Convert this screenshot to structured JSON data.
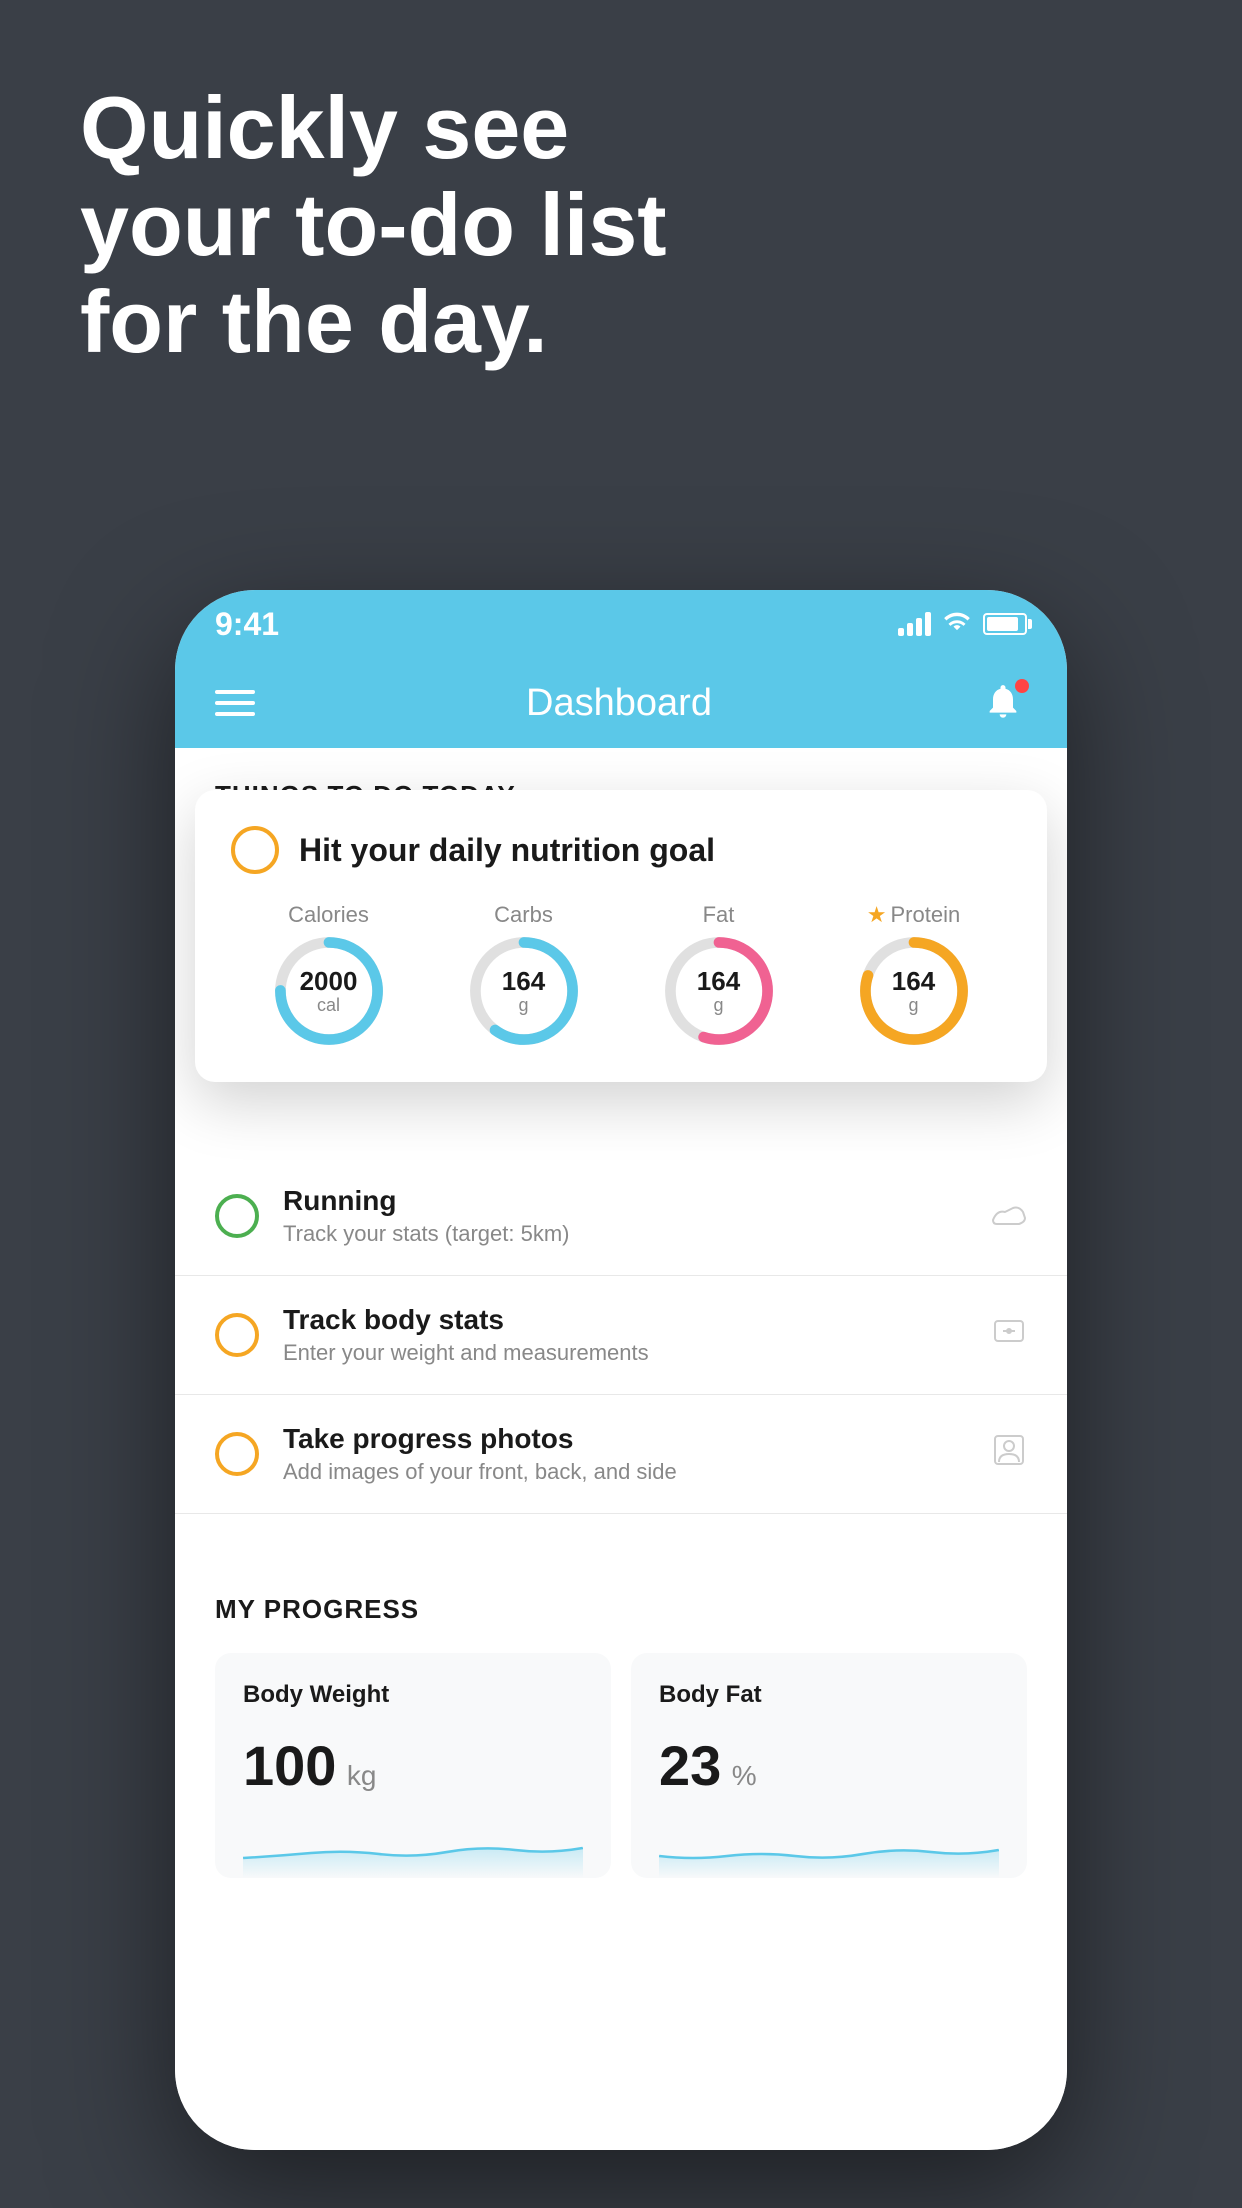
{
  "background_color": "#3a3f47",
  "headline": {
    "line1": "Quickly see",
    "line2": "your to-do list",
    "line3": "for the day."
  },
  "status_bar": {
    "time": "9:41",
    "color": "#5bc8e8"
  },
  "nav": {
    "title": "Dashboard",
    "color": "#5bc8e8"
  },
  "things_section": {
    "title": "THINGS TO DO TODAY"
  },
  "nutrition_card": {
    "title": "Hit your daily nutrition goal",
    "items": [
      {
        "label": "Calories",
        "value": "2000",
        "unit": "cal",
        "color": "#5bc8e8",
        "track_color": "#e0e0e0",
        "pct": 75
      },
      {
        "label": "Carbs",
        "value": "164",
        "unit": "g",
        "color": "#5bc8e8",
        "track_color": "#e0e0e0",
        "pct": 60
      },
      {
        "label": "Fat",
        "value": "164",
        "unit": "g",
        "color": "#f06292",
        "track_color": "#e0e0e0",
        "pct": 55
      },
      {
        "label": "Protein",
        "value": "164",
        "unit": "g",
        "color": "#f5a623",
        "track_color": "#e0e0e0",
        "pct": 80,
        "starred": true
      }
    ]
  },
  "todo_items": [
    {
      "title": "Running",
      "subtitle": "Track your stats (target: 5km)",
      "circle_color": "#4caf50",
      "icon": "shoe"
    },
    {
      "title": "Track body stats",
      "subtitle": "Enter your weight and measurements",
      "circle_color": "#f5a623",
      "icon": "scale"
    },
    {
      "title": "Take progress photos",
      "subtitle": "Add images of your front, back, and side",
      "circle_color": "#f5a623",
      "icon": "person"
    }
  ],
  "progress_section": {
    "title": "MY PROGRESS",
    "cards": [
      {
        "title": "Body Weight",
        "value": "100",
        "unit": "kg"
      },
      {
        "title": "Body Fat",
        "value": "23",
        "unit": "%"
      }
    ]
  }
}
